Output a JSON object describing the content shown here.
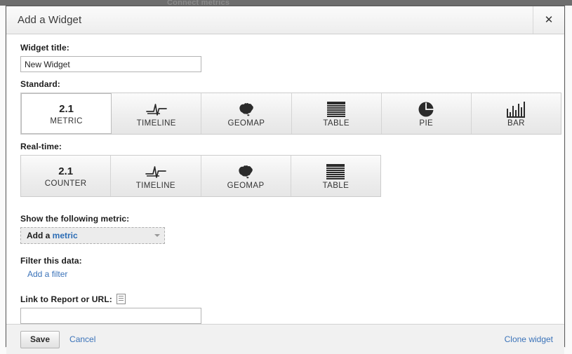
{
  "background": {
    "faint_text": "Connect metrics"
  },
  "dialog": {
    "title": "Add a Widget",
    "close_icon": "close-icon",
    "close_glyph": "✕"
  },
  "form": {
    "widget_title_label": "Widget title:",
    "widget_title_value": "New Widget",
    "widget_title_placeholder": "",
    "standard_label": "Standard:",
    "realtime_label": "Real-time:",
    "metric_label": "Show the following metric:",
    "metric_select_prefix": "Add a ",
    "metric_select_link": "metric",
    "filter_label": "Filter this data:",
    "add_filter_label": "Add a filter",
    "link_label": "Link to Report or URL:",
    "link_value": "",
    "link_placeholder": "",
    "report_icon": "report-icon"
  },
  "standard_types": [
    {
      "label": "METRIC",
      "icon": "number-2-1-icon",
      "number": "2.1",
      "selected": true
    },
    {
      "label": "TIMELINE",
      "icon": "timeline-icon",
      "selected": false
    },
    {
      "label": "GEOMAP",
      "icon": "geomap-icon",
      "selected": false
    },
    {
      "label": "TABLE",
      "icon": "table-icon",
      "selected": false
    },
    {
      "label": "PIE",
      "icon": "pie-chart-icon",
      "selected": false
    },
    {
      "label": "BAR",
      "icon": "bar-chart-icon",
      "selected": false
    }
  ],
  "realtime_types": [
    {
      "label": "COUNTER",
      "icon": "number-2-1-icon",
      "number": "2.1",
      "selected": false
    },
    {
      "label": "TIMELINE",
      "icon": "timeline-icon",
      "selected": false
    },
    {
      "label": "GEOMAP",
      "icon": "geomap-icon",
      "selected": false
    },
    {
      "label": "TABLE",
      "icon": "table-icon",
      "selected": false
    }
  ],
  "footer": {
    "save_label": "Save",
    "cancel_label": "Cancel",
    "clone_label": "Clone widget"
  },
  "colors": {
    "link": "#3b73b9",
    "metric_link": "#2b6cb5",
    "dialog_border": "#5a5a5a",
    "icon": "#2b2b2b"
  }
}
